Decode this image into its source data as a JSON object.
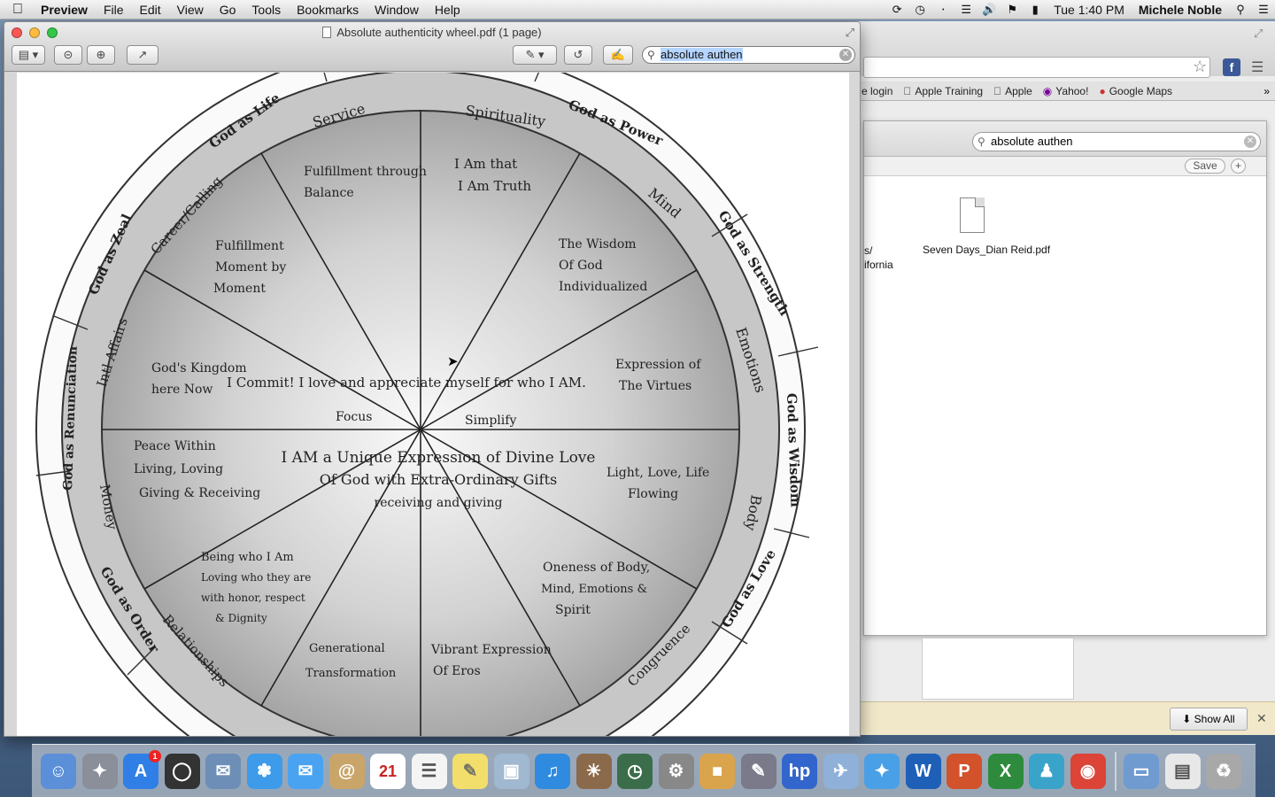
{
  "menubar": {
    "app": "Preview",
    "menus": [
      "File",
      "Edit",
      "View",
      "Go",
      "Tools",
      "Bookmarks",
      "Window",
      "Help"
    ],
    "clock": "Tue 1:40 PM",
    "user": "Michele Noble"
  },
  "preview": {
    "title": "Absolute authenticity wheel.pdf (1 page)",
    "search_value": "absolute authen"
  },
  "browser": {
    "bookmarks": [
      "e login",
      "Apple Training",
      "Apple",
      "Yahoo!",
      "Google Maps"
    ],
    "finder_search": "absolute authen",
    "save_label": "Save",
    "file_name": "Seven Days_Dian Reid.pdf",
    "side_fragment_1": "s/",
    "side_fragment_2": "ifornia",
    "show_all": "Show All"
  },
  "wheel": {
    "center_commit": "I Commit! I love and appreciate myself for who I AM.",
    "center_1": "I AM a Unique Expression of Divine Love",
    "center_2": "Of God with Extra-Ordinary Gifts",
    "center_3": "receiving and giving",
    "focus": "Focus",
    "simplify": "Simplify",
    "segments": {
      "s1_1": "I Am that",
      "s1_2": "I Am Truth",
      "s2_1": "The Wisdom",
      "s2_2": "Of God",
      "s2_3": "Individualized",
      "s3_1": "Expression of",
      "s3_2": "The Virtues",
      "s4_1": "Light, Love, Life",
      "s4_2": "Flowing",
      "s5_1": "Oneness of Body,",
      "s5_2": "Mind, Emotions &",
      "s5_3": "Spirit",
      "s6_1": "Vibrant Expression",
      "s6_2": "Of Eros",
      "s7_1": "Generational",
      "s7_2": "Transformation",
      "s8_1": "Being who I Am",
      "s8_2": "Loving who they are",
      "s8_3": "with honor, respect",
      "s8_4": "& Dignity",
      "s9_1": "Peace Within",
      "s9_2": "Living, Loving",
      "s9_3": "Giving & Receiving",
      "s10_1": "God's Kingdom",
      "s10_2": "here Now",
      "s11_1": "Fulfillment",
      "s11_2": "Moment by",
      "s11_3": "Moment",
      "s12_1": "Fulfillment through",
      "s12_2": "Balance"
    },
    "inner_ring": {
      "spirituality": "Spirituality",
      "mind": "Mind",
      "emotions": "Emotions",
      "body": "Body",
      "congruence": "Congruence",
      "relationships": "Relationships",
      "money": "Money",
      "intl_affairs": "Intl Affairs",
      "career": "Career/Calling",
      "service": "Service"
    },
    "outer_ring": {
      "power": "God as Power",
      "strength": "God as Strength",
      "wisdom": "God as Wisdom",
      "love": "God as Love",
      "order": "God as Order",
      "renunciation": "God as Renunciation",
      "zeal": "God as Zeal",
      "life": "God as Life"
    }
  },
  "dock": {
    "mail_badge": "1",
    "calendar_day": "21"
  }
}
